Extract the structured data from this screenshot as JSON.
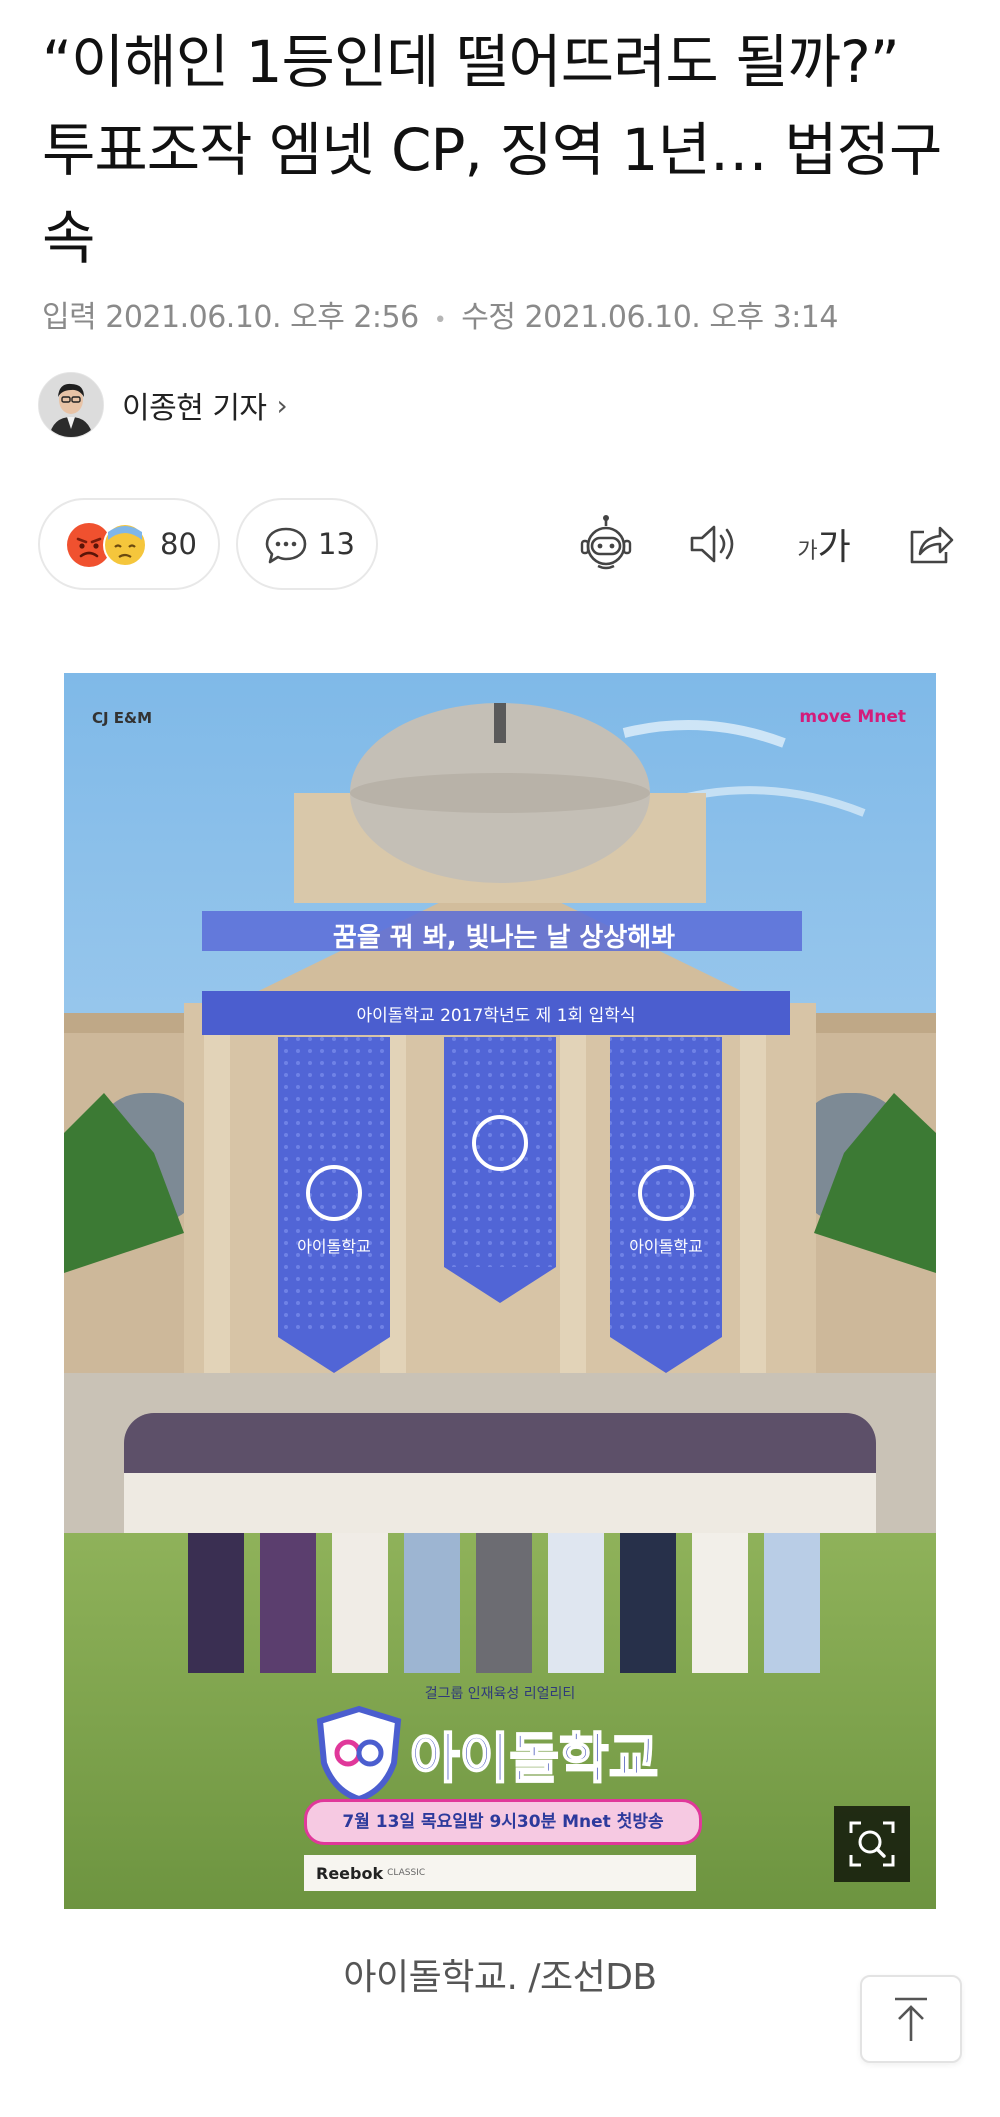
{
  "article": {
    "headline": "“이해인 1등인데 떨어뜨려도 될까?” 투표조작 엠넷 CP, 징역 1년… 법정구속",
    "input_label": "입력",
    "input_time": "2021.06.10. 오후 2:56",
    "separator": "•",
    "modified_label": "수정",
    "modified_time": "2021.06.10. 오후 3:14"
  },
  "reporter": {
    "name": "이종현 기자",
    "chevron": "›"
  },
  "reactions": {
    "count": "80",
    "icons": [
      "angry-face-icon",
      "sad-sweat-face-icon"
    ]
  },
  "comments": {
    "count": "13",
    "icon": "speech-bubble-icon"
  },
  "toolbar": {
    "robot_icon": "robot-summary-icon",
    "speaker_icon": "speaker-icon",
    "font_small": "가",
    "font_large": "가",
    "share_icon": "share-icon"
  },
  "photo": {
    "logo_left": "CJ E&M",
    "logo_right": "move Mnet",
    "banner_slogan": "꿈을 꿔 봐, 빛나는 날 상상해봐",
    "ceremony_banner": "아이돌학교 2017학년도 제 1회 입학식",
    "flag_label": "아이돌학교",
    "poster_subtitle": "걸그룹 인재육성 리얼리티",
    "poster_title": "아이돌학교",
    "airdate": "7월 13일 목요일밤 9시30분 Mnet 첫방송",
    "sponsor": "Reebok",
    "sponsor_sub": "CLASSIC"
  },
  "caption": "아이돌학교. /조선DB",
  "colors": {
    "text_dark": "#111111",
    "meta_gray": "#8a8a8a",
    "banner_blue": "#4d5fd0",
    "airdate_pink": "#e0389a"
  }
}
